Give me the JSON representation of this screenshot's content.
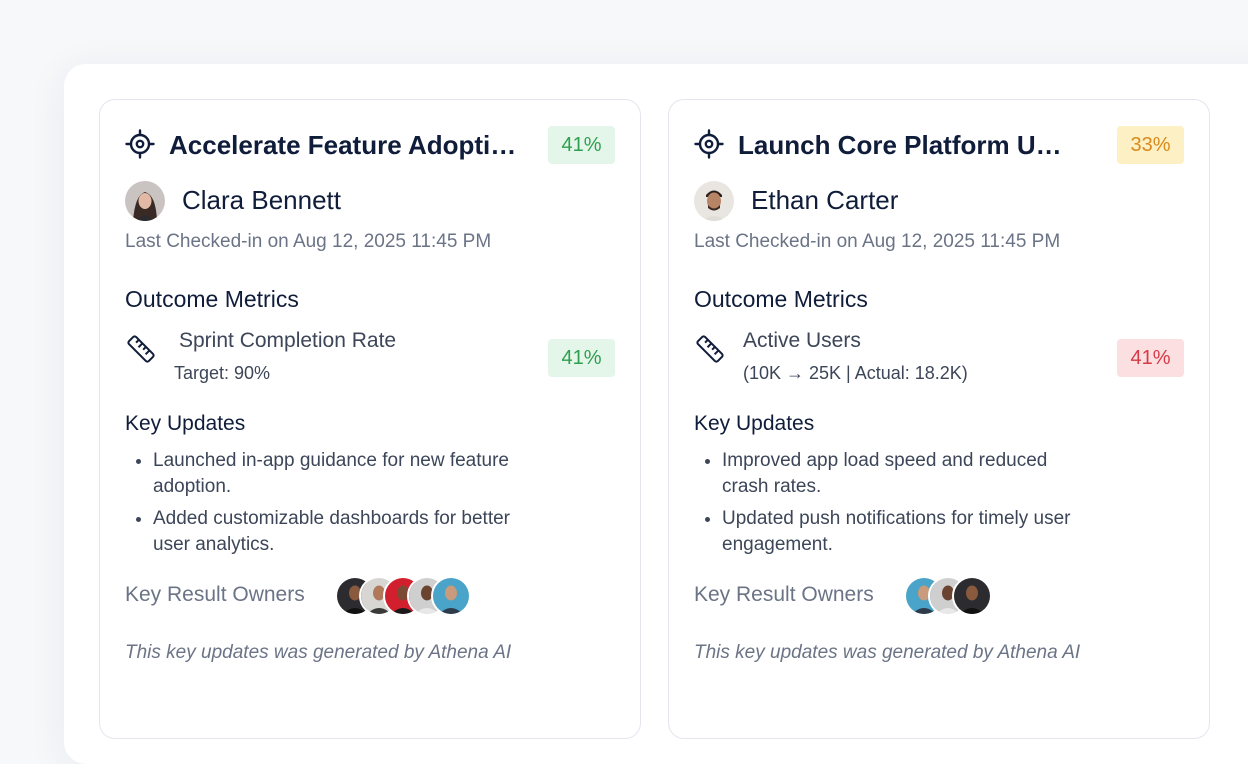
{
  "cards": [
    {
      "title": "Accelerate Feature Adoption",
      "progress_label": "41%",
      "progress_color": "green",
      "owner": {
        "name": "Clara Bennett"
      },
      "last_checkin": "Last Checked-in on Aug 12, 2025 11:45 PM",
      "metrics_heading": "Outcome Metrics",
      "metric": {
        "name": "Sprint Completion Rate",
        "detail": "Target: 90%",
        "value_label": "41%",
        "value_color": "green"
      },
      "updates_heading": "Key Updates",
      "updates": [
        "Launched in-app guidance for new feature adoption.",
        "Added customizable dashboards for better user analytics."
      ],
      "kr_owners_label": "Key Result Owners",
      "footer_note": "This key updates was generated by Athena AI"
    },
    {
      "title": "Launch Core Platform Upgrade",
      "progress_label": "33%",
      "progress_color": "yellow",
      "owner": {
        "name": "Ethan Carter"
      },
      "last_checkin": "Last Checked-in on Aug 12, 2025 11:45 PM",
      "metrics_heading": "Outcome Metrics",
      "metric": {
        "name": "Active Users",
        "detail": "(10K → 25K | Actual: 18.2K)",
        "value_label": "41%",
        "value_color": "red"
      },
      "updates_heading": "Key Updates",
      "updates": [
        "Improved app load speed and reduced crash rates.",
        "Updated push notifications for timely user engagement."
      ],
      "kr_owners_label": "Key Result Owners",
      "footer_note": "This key updates was generated by Athena AI"
    }
  ]
}
